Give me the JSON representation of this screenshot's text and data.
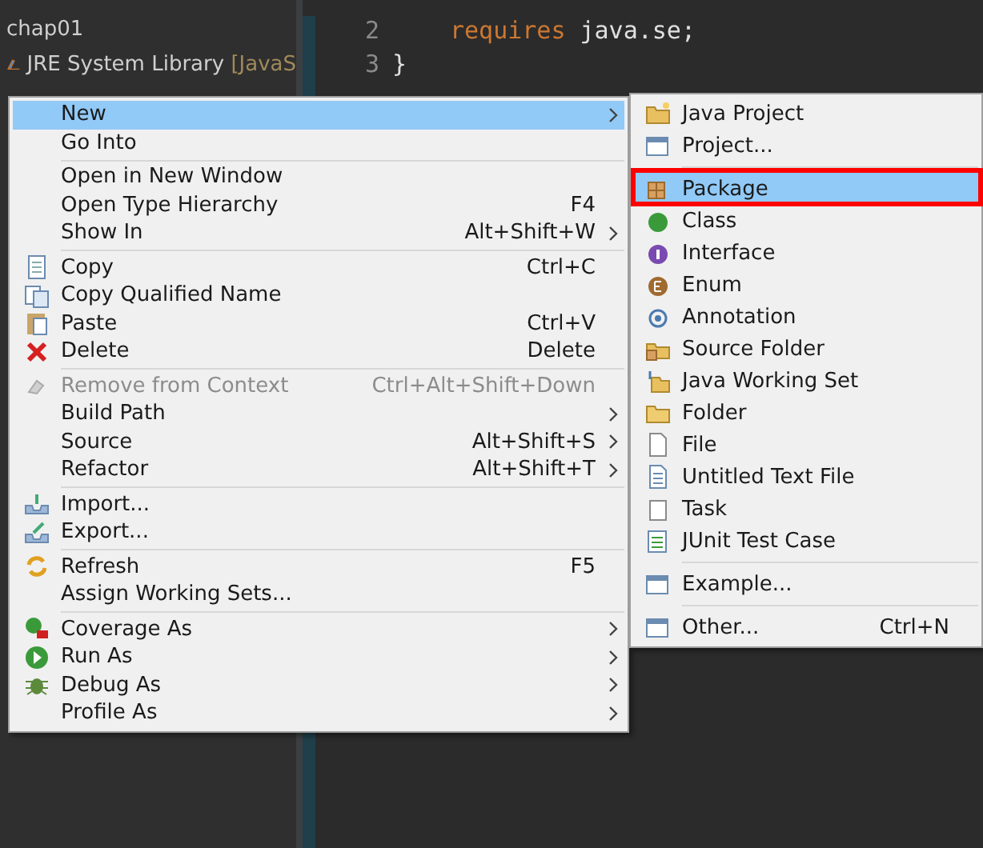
{
  "explorer": {
    "items": [
      {
        "label": "chap01",
        "kind": "project"
      },
      {
        "label": "JRE System Library",
        "suffix": "[JavaS",
        "kind": "library"
      }
    ]
  },
  "editor": {
    "lines": [
      {
        "number": "2",
        "keyword": "requires",
        "text": "java.se;"
      },
      {
        "number": "3",
        "text": "}"
      }
    ]
  },
  "context_menu": {
    "groups": [
      [
        {
          "label": "New",
          "has_submenu": true,
          "selected": true,
          "disabled": false
        },
        {
          "label": "Go Into",
          "has_submenu": false,
          "selected": false,
          "disabled": false
        }
      ],
      [
        {
          "label": "Open in New Window",
          "has_submenu": false,
          "selected": false,
          "disabled": false
        },
        {
          "label": "Open Type Hierarchy",
          "shortcut": "F4",
          "has_submenu": false,
          "selected": false,
          "disabled": false
        },
        {
          "label": "Show In",
          "shortcut": "Alt+Shift+W",
          "has_submenu": true,
          "selected": false,
          "disabled": false
        }
      ],
      [
        {
          "label": "Copy",
          "shortcut": "Ctrl+C",
          "has_submenu": false,
          "selected": false,
          "disabled": false
        },
        {
          "label": "Copy Qualified Name",
          "has_submenu": false,
          "selected": false,
          "disabled": false
        },
        {
          "label": "Paste",
          "shortcut": "Ctrl+V",
          "has_submenu": false,
          "selected": false,
          "disabled": false
        },
        {
          "label": "Delete",
          "shortcut": "Delete",
          "has_submenu": false,
          "selected": false,
          "disabled": false
        }
      ],
      [
        {
          "label": "Remove from Context",
          "shortcut": "Ctrl+Alt+Shift+Down",
          "has_submenu": false,
          "selected": false,
          "disabled": true
        },
        {
          "label": "Build Path",
          "has_submenu": true,
          "selected": false,
          "disabled": false
        },
        {
          "label": "Source",
          "shortcut": "Alt+Shift+S",
          "has_submenu": true,
          "selected": false,
          "disabled": false
        },
        {
          "label": "Refactor",
          "shortcut": "Alt+Shift+T",
          "has_submenu": true,
          "selected": false,
          "disabled": false
        }
      ],
      [
        {
          "label": "Import...",
          "has_submenu": false,
          "selected": false,
          "disabled": false
        },
        {
          "label": "Export...",
          "has_submenu": false,
          "selected": false,
          "disabled": false
        }
      ],
      [
        {
          "label": "Refresh",
          "shortcut": "F5",
          "has_submenu": false,
          "selected": false,
          "disabled": false
        },
        {
          "label": "Assign Working Sets...",
          "has_submenu": false,
          "selected": false,
          "disabled": false
        }
      ],
      [
        {
          "label": "Coverage As",
          "has_submenu": true,
          "selected": false,
          "disabled": false
        },
        {
          "label": "Run As",
          "has_submenu": true,
          "selected": false,
          "disabled": false
        },
        {
          "label": "Debug As",
          "has_submenu": true,
          "selected": false,
          "disabled": false
        },
        {
          "label": "Profile As",
          "has_submenu": true,
          "selected": false,
          "disabled": false
        }
      ]
    ]
  },
  "submenu": {
    "groups": [
      [
        {
          "label": "Java Project",
          "selected": false,
          "highlighted": false
        },
        {
          "label": "Project...",
          "selected": false,
          "highlighted": false
        }
      ],
      [
        {
          "label": "Package",
          "selected": true,
          "highlighted": true
        },
        {
          "label": "Class",
          "selected": false,
          "highlighted": false
        },
        {
          "label": "Interface",
          "selected": false,
          "highlighted": false
        },
        {
          "label": "Enum",
          "selected": false,
          "highlighted": false
        },
        {
          "label": "Annotation",
          "selected": false,
          "highlighted": false
        },
        {
          "label": "Source Folder",
          "selected": false,
          "highlighted": false
        },
        {
          "label": "Java Working Set",
          "selected": false,
          "highlighted": false
        },
        {
          "label": "Folder",
          "selected": false,
          "highlighted": false
        },
        {
          "label": "File",
          "selected": false,
          "highlighted": false
        },
        {
          "label": "Untitled Text File",
          "selected": false,
          "highlighted": false
        },
        {
          "label": "Task",
          "selected": false,
          "highlighted": false
        },
        {
          "label": "JUnit Test Case",
          "selected": false,
          "highlighted": false
        }
      ],
      [
        {
          "label": "Example...",
          "selected": false,
          "highlighted": false
        }
      ],
      [
        {
          "label": "Other...",
          "shortcut": "Ctrl+N",
          "selected": false,
          "highlighted": false
        }
      ]
    ]
  }
}
